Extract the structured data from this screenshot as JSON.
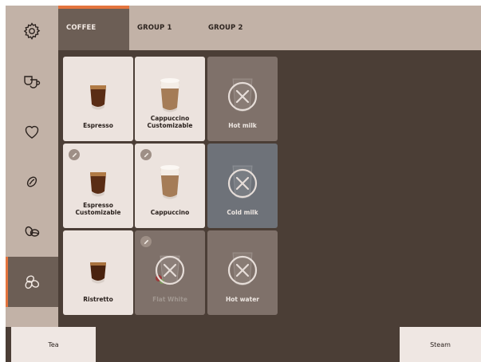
{
  "sidebar": {
    "items": [
      {
        "name": "settings",
        "icon": "gear-icon",
        "active": false
      },
      {
        "name": "cups",
        "icon": "cups-icon",
        "active": false
      },
      {
        "name": "favorites",
        "icon": "heart-icon",
        "active": false
      },
      {
        "name": "bean",
        "icon": "coffee-bean-icon",
        "active": false
      },
      {
        "name": "two-beans",
        "icon": "two-beans-icon",
        "active": false
      },
      {
        "name": "three-beans",
        "icon": "three-beans-icon",
        "active": true
      }
    ]
  },
  "tabs": [
    {
      "label": "COFFEE",
      "active": true
    },
    {
      "label": "GROUP 1",
      "active": false
    },
    {
      "label": "GROUP 2",
      "active": false
    }
  ],
  "drinks": [
    {
      "label": "Espresso",
      "type": "espresso",
      "state": "available",
      "editable": false
    },
    {
      "label": "Cappuccino\nCustomizable",
      "type": "cappuccino",
      "state": "available",
      "editable": false
    },
    {
      "label": "Hot milk",
      "type": "glass",
      "state": "disabled",
      "editable": false
    },
    {
      "label": "Espresso\nCustomizable",
      "type": "espresso",
      "state": "available",
      "editable": true
    },
    {
      "label": "Cappuccino",
      "type": "cappuccino",
      "state": "available",
      "editable": true
    },
    {
      "label": "Cold milk",
      "type": "glass",
      "state": "disabled",
      "editable": false
    },
    {
      "label": "Ristretto",
      "type": "ristretto",
      "state": "available",
      "editable": false
    },
    {
      "label": "Flat White",
      "type": "flatwhite",
      "state": "faded",
      "editable": true
    },
    {
      "label": "Hot water",
      "type": "glass",
      "state": "disabled",
      "editable": false
    }
  ],
  "bottom": {
    "left_label": "Tea",
    "right_label": "Steam"
  },
  "colors": {
    "accent": "#e3743e",
    "background": "#4b3e36",
    "sidebar": "#c2b2a7",
    "active_tab": "#6c5e55",
    "card": "#ece3de"
  }
}
